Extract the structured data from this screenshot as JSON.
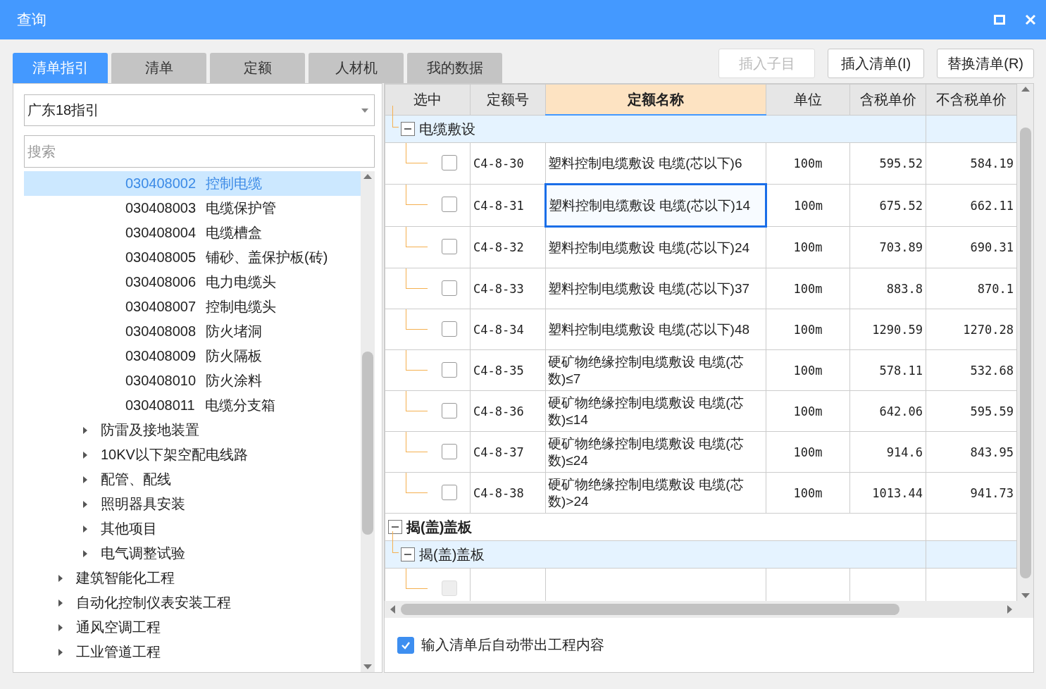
{
  "window": {
    "title": "查询"
  },
  "tabs": [
    {
      "label": "清单指引",
      "selected": true
    },
    {
      "label": "清单",
      "selected": false
    },
    {
      "label": "定额",
      "selected": false
    },
    {
      "label": "人材机",
      "selected": false
    },
    {
      "label": "我的数据",
      "selected": false
    }
  ],
  "buttons": [
    {
      "label": "插入子目",
      "disabled": true
    },
    {
      "label": "插入清单(I)",
      "disabled": false
    },
    {
      "label": "替换清单(R)",
      "disabled": false
    }
  ],
  "sidebar": {
    "dropdown": {
      "value": "广东18指引"
    },
    "search": {
      "placeholder": "搜索"
    },
    "tree": [
      {
        "children": [
          {
            "children": [
              {
                "code": "030408002",
                "name": "控制电缆",
                "selected": true
              },
              {
                "code": "030408003",
                "name": "电缆保护管",
                "selected": false
              },
              {
                "code": "030408004",
                "name": "电缆槽盒",
                "selected": false
              },
              {
                "code": "030408005",
                "name": "铺砂、盖保护板(砖)",
                "selected": false
              },
              {
                "code": "030408006",
                "name": "电力电缆头",
                "selected": false
              },
              {
                "code": "030408007",
                "name": "控制电缆头",
                "selected": false
              },
              {
                "code": "030408008",
                "name": "防火堵洞",
                "selected": false
              },
              {
                "code": "030408009",
                "name": "防火隔板",
                "selected": false
              },
              {
                "code": "030408010",
                "name": "防火涂料",
                "selected": false
              },
              {
                "code": "030408011",
                "name": "电缆分支箱",
                "selected": false
              }
            ]
          },
          {
            "label": "防雷及接地装置",
            "expanded": false
          },
          {
            "label": "10KV以下架空配电线路",
            "expanded": false
          },
          {
            "label": "配管、配线",
            "expanded": false
          },
          {
            "label": "照明器具安装",
            "expanded": false
          },
          {
            "label": "其他项目",
            "expanded": false
          },
          {
            "label": "电气调整试验",
            "expanded": false
          }
        ]
      },
      {
        "label": "建筑智能化工程",
        "expanded": false
      },
      {
        "label": "自动化控制仪表安装工程",
        "expanded": false
      },
      {
        "label": "通风空调工程",
        "expanded": false
      },
      {
        "label": "工业管道工程",
        "expanded": false
      }
    ]
  },
  "table": {
    "columns": [
      {
        "label": "选中",
        "sorted": false
      },
      {
        "label": "定额号",
        "sorted": false
      },
      {
        "label": "定额名称",
        "sorted": true
      },
      {
        "label": "单位",
        "sorted": false
      },
      {
        "label": "含税单价",
        "sorted": false
      },
      {
        "label": "不含税单价",
        "sorted": false
      }
    ],
    "rows": [
      {
        "children": [
          {
            "label": "电缆敷设",
            "expanded": true,
            "children": [
              {
                "checked": false,
                "code": "C4-8-30",
                "name": "塑料控制电缆敷设 电缆(芯以下)6",
                "unit": "100m",
                "tax_price": "595.52",
                "price": "584.19",
                "selected": false
              },
              {
                "checked": false,
                "code": "C4-8-31",
                "name": "塑料控制电缆敷设 电缆(芯以下)14",
                "unit": "100m",
                "tax_price": "675.52",
                "price": "662.11",
                "selected": true
              },
              {
                "checked": false,
                "code": "C4-8-32",
                "name": "塑料控制电缆敷设 电缆(芯以下)24",
                "unit": "100m",
                "tax_price": "703.89",
                "price": "690.31",
                "selected": false
              },
              {
                "checked": false,
                "code": "C4-8-33",
                "name": "塑料控制电缆敷设 电缆(芯以下)37",
                "unit": "100m",
                "tax_price": "883.8",
                "price": "870.1",
                "selected": false
              },
              {
                "checked": false,
                "code": "C4-8-34",
                "name": "塑料控制电缆敷设 电缆(芯以下)48",
                "unit": "100m",
                "tax_price": "1290.59",
                "price": "1270.28",
                "selected": false
              },
              {
                "checked": false,
                "code": "C4-8-35",
                "name": "硬矿物绝缘控制电缆敷设 电缆(芯数)≤7",
                "unit": "100m",
                "tax_price": "578.11",
                "price": "532.68",
                "selected": false
              },
              {
                "checked": false,
                "code": "C4-8-36",
                "name": "硬矿物绝缘控制电缆敷设 电缆(芯数)≤14",
                "unit": "100m",
                "tax_price": "642.06",
                "price": "595.59",
                "selected": false
              },
              {
                "checked": false,
                "code": "C4-8-37",
                "name": "硬矿物绝缘控制电缆敷设 电缆(芯数)≤24",
                "unit": "100m",
                "tax_price": "914.6",
                "price": "843.95",
                "selected": false
              },
              {
                "checked": false,
                "code": "C4-8-38",
                "name": "硬矿物绝缘控制电缆敷设 电缆(芯数)>24",
                "unit": "100m",
                "tax_price": "1013.44",
                "price": "941.73",
                "selected": false
              }
            ]
          }
        ]
      },
      {
        "label": "揭(盖)盖板",
        "expanded": true,
        "children": [
          {
            "label": "揭(盖)盖板",
            "expanded": true,
            "children": [
              {
                "checked": false,
                "disabled": true,
                "selected": false
              }
            ]
          }
        ]
      }
    ]
  },
  "option": {
    "label": "输入清单后自动带出工程内容",
    "checked": true
  }
}
